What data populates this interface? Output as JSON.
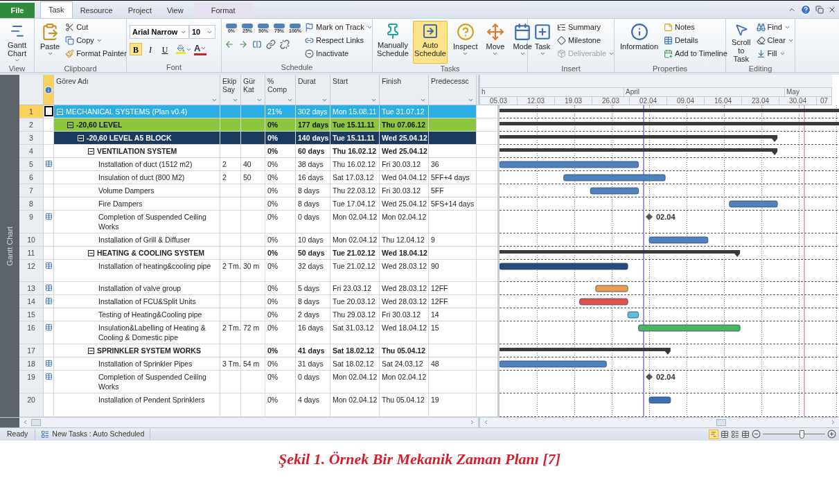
{
  "tabs": [
    {
      "label": "File",
      "kind": "file",
      "selected": false
    },
    {
      "label": "Task",
      "kind": "tab",
      "selected": true
    },
    {
      "label": "Resource",
      "kind": "tab",
      "selected": false
    },
    {
      "label": "Project",
      "kind": "tab",
      "selected": false
    },
    {
      "label": "View",
      "kind": "tab",
      "selected": false
    },
    {
      "label": "Format",
      "kind": "contextual",
      "selected": false
    }
  ],
  "ribbon": {
    "view": {
      "label": "View",
      "gantt_chart": "Gantt Chart"
    },
    "clipboard": {
      "label": "Clipboard",
      "paste": "Paste",
      "cut": "Cut",
      "copy": "Copy",
      "format_painter": "Format Painter"
    },
    "font": {
      "label": "Font",
      "family": "Arial Narrow",
      "size": "10",
      "styles": [
        {
          "label": "B",
          "on": true
        },
        {
          "label": "I",
          "on": false
        },
        {
          "label": "U",
          "on": false
        }
      ],
      "font_color_glyph": "A"
    },
    "schedule": {
      "label": "Schedule",
      "percent_buttons": [
        "0%",
        "25%",
        "50%",
        "75%",
        "100%"
      ],
      "mark_on_track": "Mark on Track",
      "respect_links": "Respect Links",
      "inactivate": "Inactivate"
    },
    "tasks": {
      "label": "Tasks",
      "modes": [
        {
          "label": "Manually Schedule",
          "selected": false
        },
        {
          "label": "Auto Schedule",
          "selected": true
        }
      ],
      "inspect": "Inspect",
      "move": "Move",
      "mode": "Mode"
    },
    "insert": {
      "label": "Insert",
      "task": "Task",
      "items": [
        {
          "label": "Summary",
          "disabled": false
        },
        {
          "label": "Milestone",
          "disabled": false
        },
        {
          "label": "Deliverable",
          "disabled": true
        }
      ]
    },
    "properties": {
      "label": "Properties",
      "information": "Information",
      "notes": "Notes",
      "details": "Details",
      "add_to_timeline": "Add to Timeline"
    },
    "editing": {
      "label": "Editing",
      "scroll_to_task": "Scroll to Task",
      "find": "Find",
      "clear": "Clear",
      "fill": "Fill"
    }
  },
  "side_tab": "Gantt Chart",
  "table": {
    "columns": [
      "Görev Adı",
      "Ekip Say",
      "Gür Kat",
      "% Comp",
      "Durat",
      "Start",
      "Finish",
      "Predecessc"
    ],
    "rows": [
      {
        "id": "1",
        "name": "MECHANICAL SYSTEMS (Plan v0.4)",
        "complete": "21%",
        "duration": "302 days",
        "start": "Mon 15.08.11",
        "finish": "Tue 31.07.12",
        "kind": "project",
        "selected": true,
        "indicator": false,
        "expanded": true,
        "color": "#2aaee4",
        "children": [
          {
            "id": "2",
            "name": "-20,60 LEVEL",
            "complete": "0%",
            "duration": "177 days",
            "start": "Tue 15.11.11",
            "finish": "Thu 07.06.12",
            "kind": "summary",
            "selected": false,
            "indicator": false,
            "expanded": true,
            "color": "#8cc63e",
            "children": [
              {
                "id": "3",
                "name": "-20,60 LEVEL A5 BLOCK",
                "complete": "0%",
                "duration": "140 days",
                "start": "Tue 15.11.11",
                "finish": "Wed 25.04.12",
                "kind": "summary",
                "selected": false,
                "indicator": false,
                "expanded": true,
                "color": "#1b3a5e",
                "children": [
                  {
                    "id": "4",
                    "name": "VENTILATION SYSTEM",
                    "complete": "0%",
                    "duration": "60 days",
                    "start": "Thu 16.02.12",
                    "finish": "Wed 25.04.12",
                    "kind": "summary",
                    "selected": false,
                    "indicator": false,
                    "expanded": true,
                    "children": [
                      {
                        "id": "5",
                        "name": "Installation of duct (1512 m2)",
                        "team": "2",
                        "quantity": "40",
                        "complete": "0%",
                        "duration": "38 days",
                        "start": "Thu 16.02.12",
                        "finish": "Fri 30.03.12",
                        "predecessors": "36",
                        "kind": "task",
                        "selected": false,
                        "indicator": true,
                        "color": "#4f81bd"
                      },
                      {
                        "id": "6",
                        "name": "Insulation of duct (800 M2)",
                        "team": "2",
                        "quantity": "50",
                        "complete": "0%",
                        "duration": "16 days",
                        "start": "Sat 17.03.12",
                        "finish": "Wed 04.04.12",
                        "predecessors": "5FF+4 days",
                        "kind": "task",
                        "selected": false,
                        "indicator": false,
                        "color": "#4f81bd"
                      },
                      {
                        "id": "7",
                        "name": "Volume Dampers",
                        "complete": "0%",
                        "duration": "8 days",
                        "start": "Thu 22.03.12",
                        "finish": "Fri 30.03.12",
                        "predecessors": "5FF",
                        "kind": "task",
                        "selected": false,
                        "indicator": false,
                        "color": "#4f81bd"
                      },
                      {
                        "id": "8",
                        "name": "Fire Dampers",
                        "complete": "0%",
                        "duration": "8 days",
                        "start": "Tue 17.04.12",
                        "finish": "Wed 25.04.12",
                        "predecessors": "5FS+14 days",
                        "kind": "task",
                        "selected": false,
                        "indicator": false,
                        "color": "#4f81bd"
                      },
                      {
                        "id": "9",
                        "name": "Completion of Suspended Ceiling Works",
                        "complete": "0%",
                        "duration": "0 days",
                        "start": "Mon 02.04.12",
                        "finish": "Mon 02.04.12",
                        "kind": "milestone",
                        "selected": false,
                        "indicator": true,
                        "milestone_label": "02.04"
                      },
                      {
                        "id": "10",
                        "name": "Installation of Grill & Diffuser",
                        "complete": "0%",
                        "duration": "10 days",
                        "start": "Mon 02.04.12",
                        "finish": "Thu 12.04.12",
                        "predecessors": "9",
                        "kind": "task",
                        "selected": false,
                        "indicator": false,
                        "color": "#4f81bd"
                      }
                    ]
                  },
                  {
                    "id": "11",
                    "name": "HEATING & COOLING SYSTEM",
                    "complete": "0%",
                    "duration": "50 days",
                    "start": "Tue 21.02.12",
                    "finish": "Wed 18.04.12",
                    "kind": "summary",
                    "selected": false,
                    "indicator": false,
                    "expanded": true,
                    "children": [
                      {
                        "id": "12",
                        "name": "Installation of heating&cooling pipe",
                        "team": "2 Tm.",
                        "quantity": "30 m",
                        "complete": "0%",
                        "duration": "32 days",
                        "start": "Tue 21.02.12",
                        "finish": "Wed 28.03.12",
                        "predecessors": "90",
                        "kind": "task",
                        "selected": false,
                        "indicator": true,
                        "color": "#27497c"
                      },
                      {
                        "id": "13",
                        "name": "Installation of valve group",
                        "complete": "0%",
                        "duration": "5 days",
                        "start": "Fri 23.03.12",
                        "finish": "Wed 28.03.12",
                        "predecessors": "12FF",
                        "kind": "task",
                        "selected": false,
                        "indicator": true,
                        "color": "#ee9a4d"
                      },
                      {
                        "id": "14",
                        "name": "Installation of FCU&Split Units",
                        "complete": "0%",
                        "duration": "8 days",
                        "start": "Tue 20.03.12",
                        "finish": "Wed 28.03.12",
                        "predecessors": "12FF",
                        "kind": "task",
                        "selected": false,
                        "indicator": true,
                        "color": "#e2504d"
                      },
                      {
                        "id": "15",
                        "name": "Testing of Heating&Cooling pipe",
                        "complete": "0%",
                        "duration": "2 days",
                        "start": "Thu 29.03.12",
                        "finish": "Fri 30.03.12",
                        "predecessors": "14",
                        "kind": "task",
                        "selected": false,
                        "indicator": false,
                        "color": "#5bc0de"
                      },
                      {
                        "id": "16",
                        "name": "Insulation&Labelling of Heating & Cooling & Domestic pipe",
                        "team": "2 Tm.",
                        "quantity": "72 m",
                        "complete": "0%",
                        "duration": "16 days",
                        "start": "Sat 31.03.12",
                        "finish": "Wed 18.04.12",
                        "predecessors": "15",
                        "kind": "task",
                        "selected": false,
                        "indicator": true,
                        "color": "#4cb461"
                      }
                    ]
                  },
                  {
                    "id": "17",
                    "name": "SPRINKLER SYSTEM WORKS",
                    "complete": "0%",
                    "duration": "41 days",
                    "start": "Sat 18.02.12",
                    "finish": "Thu 05.04.12",
                    "kind": "summary",
                    "selected": false,
                    "indicator": false,
                    "expanded": true,
                    "children": [
                      {
                        "id": "18",
                        "name": "Installation of Sprinkler Pipes",
                        "team": "3 Tm.",
                        "quantity": "54 m",
                        "complete": "0%",
                        "duration": "31 days",
                        "start": "Sat 18.02.12",
                        "finish": "Sat 24.03.12",
                        "predecessors": "48",
                        "kind": "task",
                        "selected": false,
                        "indicator": true,
                        "color": "#4f81bd"
                      },
                      {
                        "id": "19",
                        "name": "Completion of Suspended Ceiling Works",
                        "complete": "0%",
                        "duration": "0 days",
                        "start": "Mon 02.04.12",
                        "finish": "Mon 02.04.12",
                        "kind": "milestone",
                        "selected": false,
                        "indicator": true,
                        "milestone_label": "02.04"
                      },
                      {
                        "id": "20",
                        "name": "Installation of Pendent Sprinklers",
                        "complete": "0%",
                        "duration": "4 days",
                        "start": "Mon 02.04.12",
                        "finish": "Thu 05.04.12",
                        "predecessors": "19",
                        "kind": "task",
                        "selected": false,
                        "indicator": false,
                        "color": "#3f6fb0"
                      }
                    ]
                  }
                ]
              }
            ]
          }
        ]
      }
    ]
  },
  "gantt": {
    "months": [
      "h",
      "April",
      "May"
    ],
    "weeks": [
      "05.03",
      "12.03",
      "19.03",
      "26.03",
      "02.04",
      "09.04",
      "16.04",
      "23.04",
      "30.04",
      "07"
    ]
  },
  "status_bar": {
    "ready": "Ready",
    "new_tasks": "New Tasks : Auto Scheduled",
    "zoom": {
      "level": 0.62
    }
  },
  "caption": "Şekil 1. Örnek Bir Mekanik Zaman Planı [7]"
}
